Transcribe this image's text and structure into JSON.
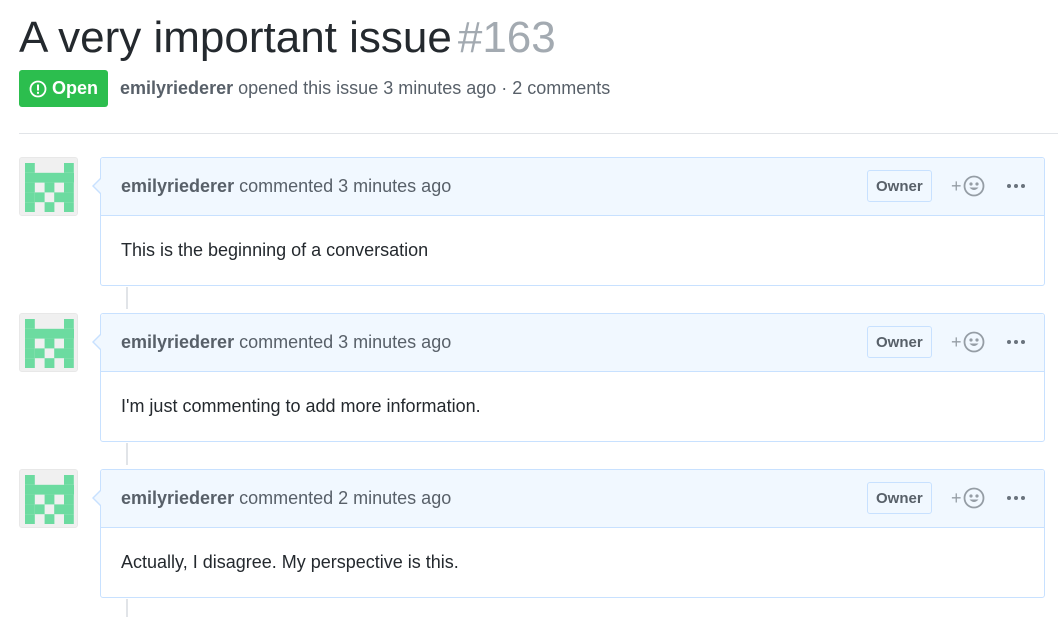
{
  "issue": {
    "title": "A very important issue",
    "number": "#163",
    "state_label": "Open",
    "state_color": "#2cbe4e",
    "author": "emilyriederer",
    "opened_text": "opened this issue 3 minutes ago · 2 comments"
  },
  "comments": [
    {
      "author": "emilyriederer",
      "action_text": "commented 3 minutes ago",
      "role_badge": "Owner",
      "body": "This is the beginning of a conversation"
    },
    {
      "author": "emilyriederer",
      "action_text": "commented 3 minutes ago",
      "role_badge": "Owner",
      "body": "I'm just commenting to add more information."
    },
    {
      "author": "emilyriederer",
      "action_text": "commented 2 minutes ago",
      "role_badge": "Owner",
      "body": "Actually, I disagree. My perspective is this."
    }
  ],
  "icons": {
    "state": "issue-opened-icon",
    "avatar": "identicon-avatar",
    "reaction": "smiley-add-reaction-icon",
    "more": "kebab-horizontal-icon"
  },
  "colors": {
    "accent_blue_border": "#c8e1ff",
    "header_bg": "#f1f8ff",
    "avatar_green": "#6cdba0"
  }
}
